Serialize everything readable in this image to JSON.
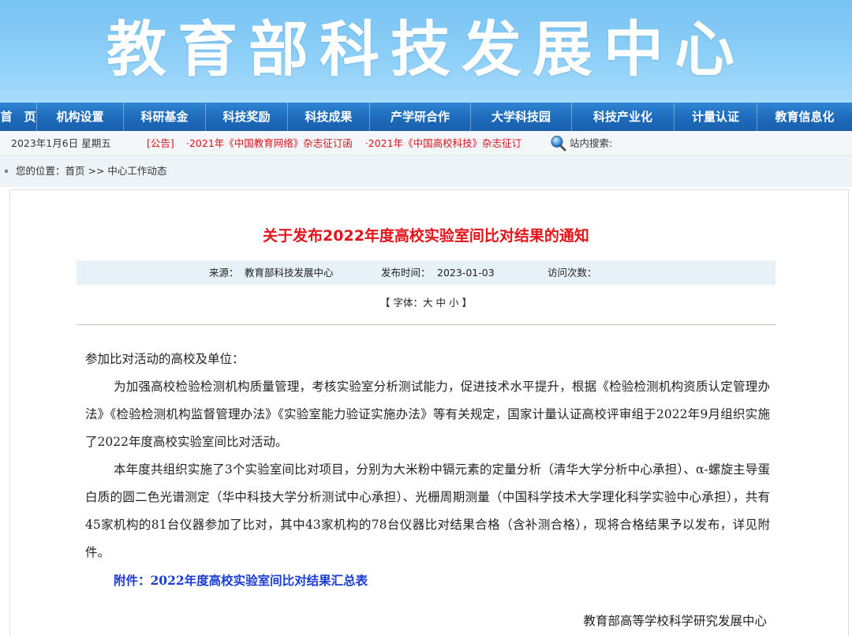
{
  "banner": {
    "title": "教育部科技发展中心"
  },
  "nav": {
    "items": [
      "首　页",
      "机构设置",
      "科研基金",
      "科技奖励",
      "科技成果",
      "产学研合作",
      "大学科技园",
      "科技产业化",
      "计量认证",
      "教育信息化"
    ]
  },
  "infobar": {
    "date": "2023年1月6日 星期五",
    "notice_label": "[公告]",
    "notices": [
      "·2021年《中国教育网络》杂志征订函",
      "·2021年《中国高校科技》杂志征订"
    ],
    "search_label": "站内搜索:"
  },
  "breadcrumb": {
    "text": "您的位置：首页 >> 中心工作动态"
  },
  "article": {
    "title": "关于发布2022年度高校实验室间比对结果的通知",
    "meta": {
      "source_label": "来源：",
      "source": "教育部科技发展中心",
      "date_label": "发布时间：",
      "date": "2023-01-03",
      "visits_label": "访问次数："
    },
    "font_size_control": "【 字体：大 中 小 】",
    "greeting": "参加比对活动的高校及单位：",
    "paragraphs": [
      "为加强高校检验检测机构质量管理，考核实验室分析测试能力，促进技术水平提升，根据《检验检测机构资质认定管理办法》《检验检测机构监督管理办法》《实验室能力验证实施办法》等有关规定，国家计量认证高校评审组于2022年9月组织实施了2022年度高校实验室间比对活动。",
      "本年度共组织实施了3个实验室间比对项目，分别为大米粉中镉元素的定量分析（清华大学分析中心承担）、α-螺旋主导蛋白质的圆二色光谱测定（华中科技大学分析测试中心承担）、光栅周期测量（中国科学技术大学理化科学实验中心承担），共有45家机构的81台仪器参加了比对，其中43家机构的78台仪器比对结果合格（含补测合格），现将合格结果予以发布，详见附件。"
    ],
    "attachment": "附件：2022年度高校实验室间比对结果汇总表",
    "signature": "教育部高等学校科学研究发展中心"
  },
  "colors": {
    "banner": "#8dcff8",
    "nav": "#1e6cbc",
    "title_red": "#e3141a",
    "notice_red": "#d2141a",
    "link_blue": "#1a3bd4"
  }
}
